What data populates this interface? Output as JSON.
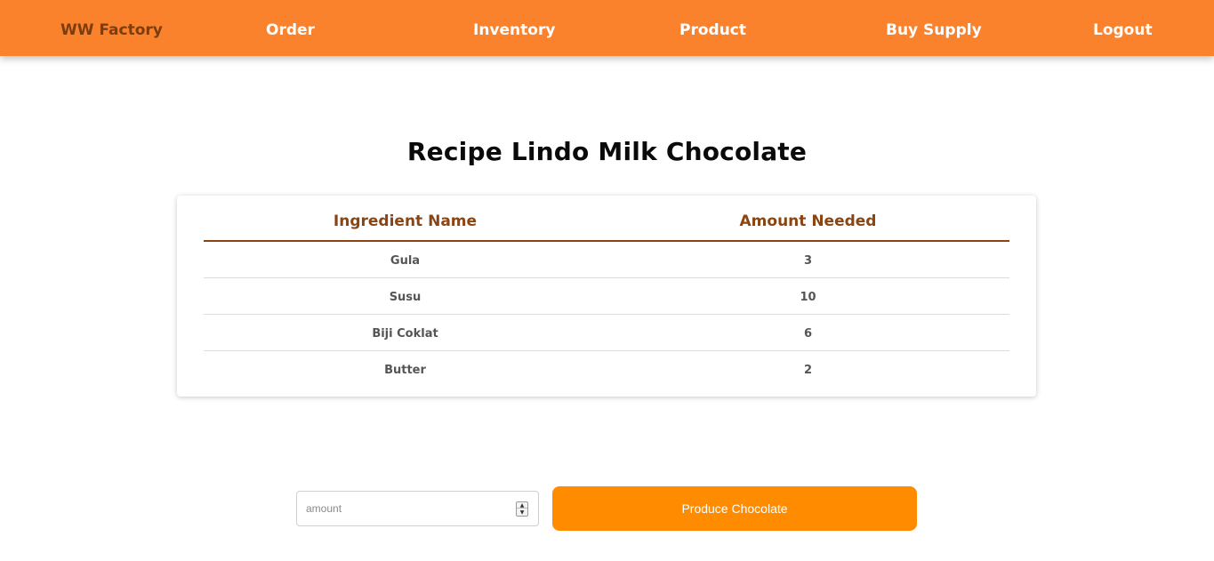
{
  "nav": {
    "brand": "WW Factory",
    "items": [
      {
        "label": "Order"
      },
      {
        "label": "Inventory"
      },
      {
        "label": "Product"
      },
      {
        "label": "Buy Supply"
      },
      {
        "label": "Logout"
      }
    ]
  },
  "page": {
    "title": "Recipe Lindo Milk Chocolate"
  },
  "table": {
    "headers": [
      "Ingredient Name",
      "Amount Needed"
    ],
    "rows": [
      [
        "Gula",
        "3"
      ],
      [
        "Susu",
        "10"
      ],
      [
        "Biji Coklat",
        "6"
      ],
      [
        "Butter",
        "2"
      ]
    ]
  },
  "form": {
    "amount_placeholder": "amount",
    "amount_value": "",
    "produce_label": "Produce Chocolate"
  },
  "colors": {
    "navbar": "#fb822d",
    "brand_text": "#7a3d0f",
    "header_text": "#8b4513",
    "button": "#ff8c00"
  }
}
